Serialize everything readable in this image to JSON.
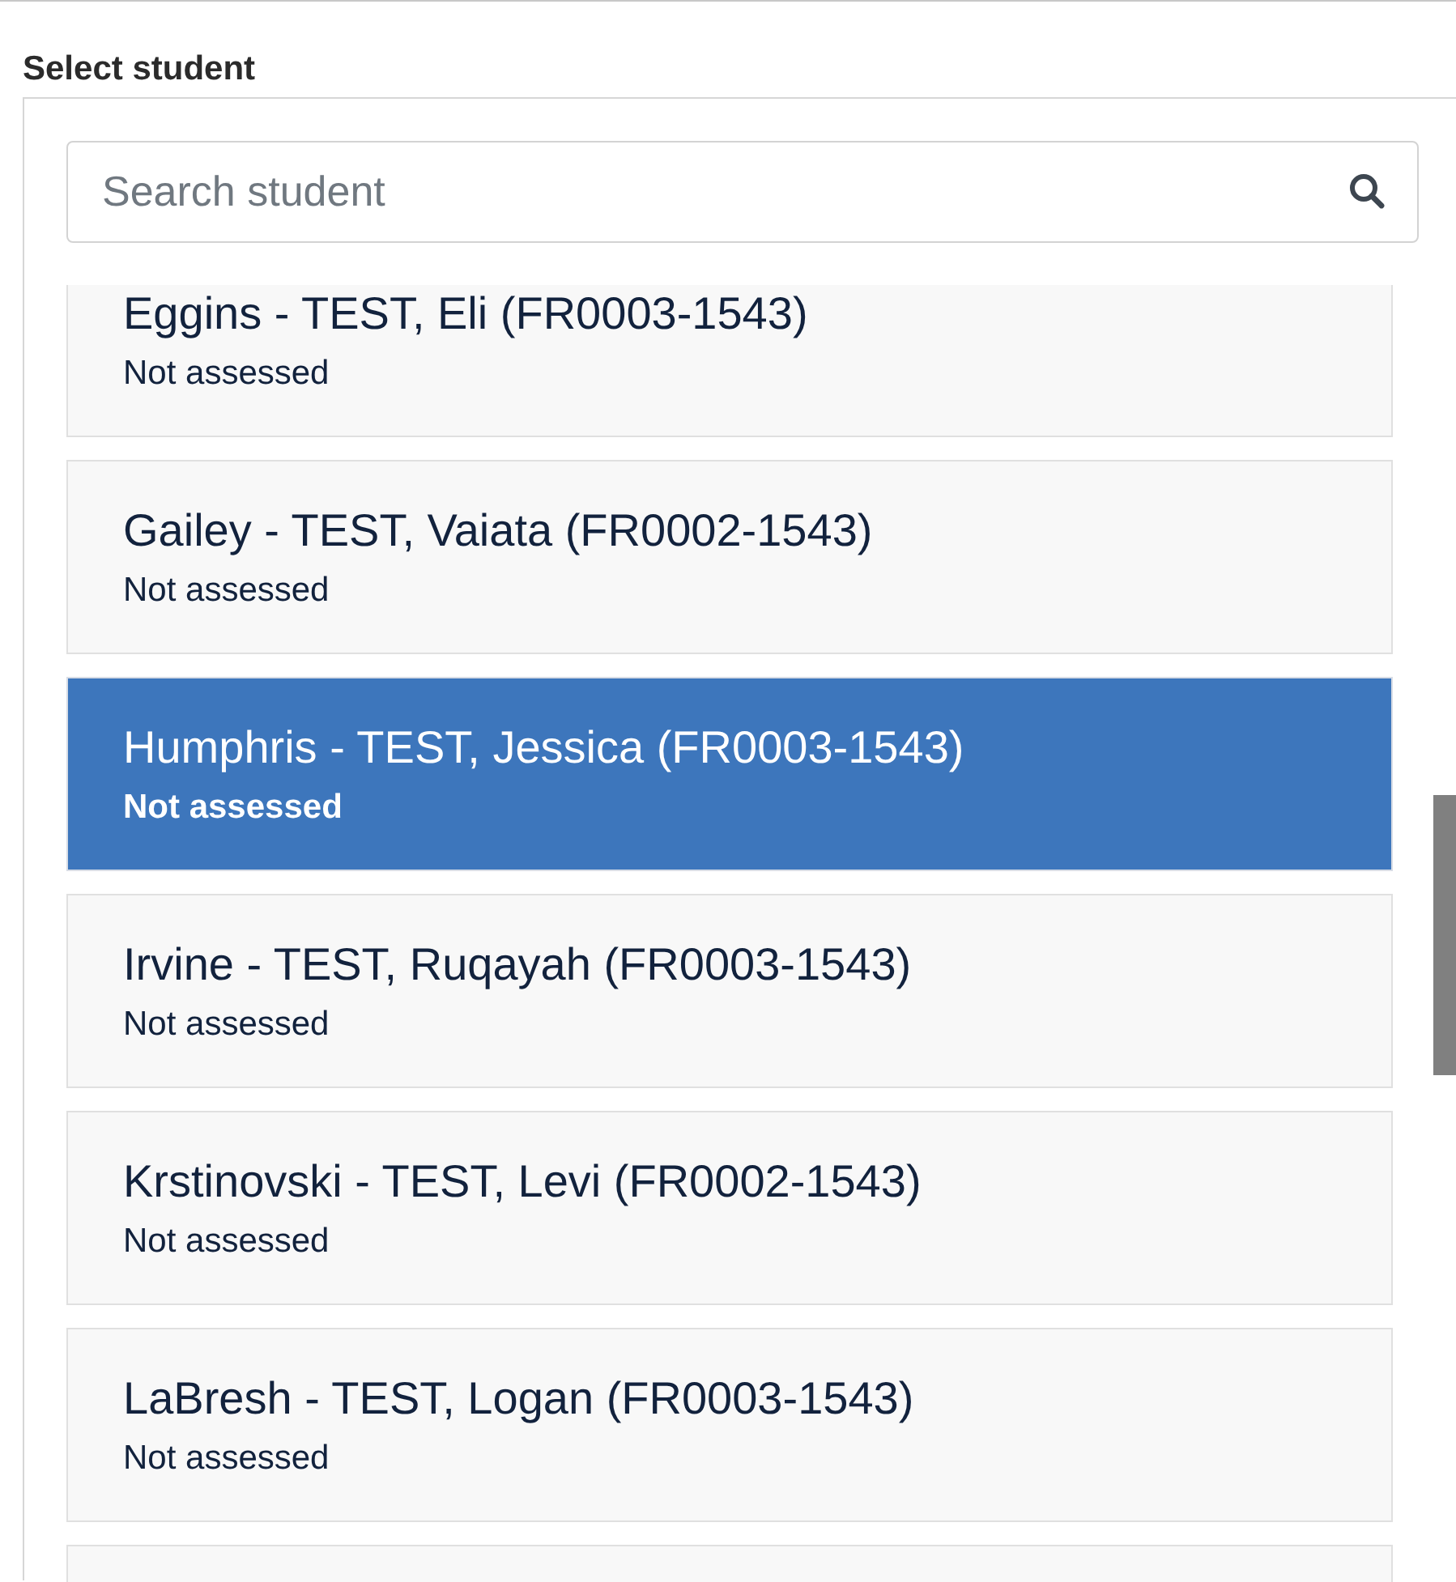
{
  "section_label": "Select student",
  "search": {
    "placeholder": "Search student"
  },
  "students": [
    {
      "name": "Eggins - TEST, Eli (FR0003-1543)",
      "status": "Not assessed",
      "selected": false
    },
    {
      "name": "Gailey - TEST, Vaiata (FR0002-1543)",
      "status": "Not assessed",
      "selected": false
    },
    {
      "name": "Humphris - TEST, Jessica (FR0003-1543)",
      "status": "Not assessed",
      "selected": true
    },
    {
      "name": "Irvine - TEST, Ruqayah (FR0003-1543)",
      "status": "Not assessed",
      "selected": false
    },
    {
      "name": "Krstinovski - TEST, Levi (FR0002-1543)",
      "status": "Not assessed",
      "selected": false
    },
    {
      "name": "LaBresh - TEST, Logan (FR0003-1543)",
      "status": "Not assessed",
      "selected": false
    }
  ],
  "more_below": true
}
